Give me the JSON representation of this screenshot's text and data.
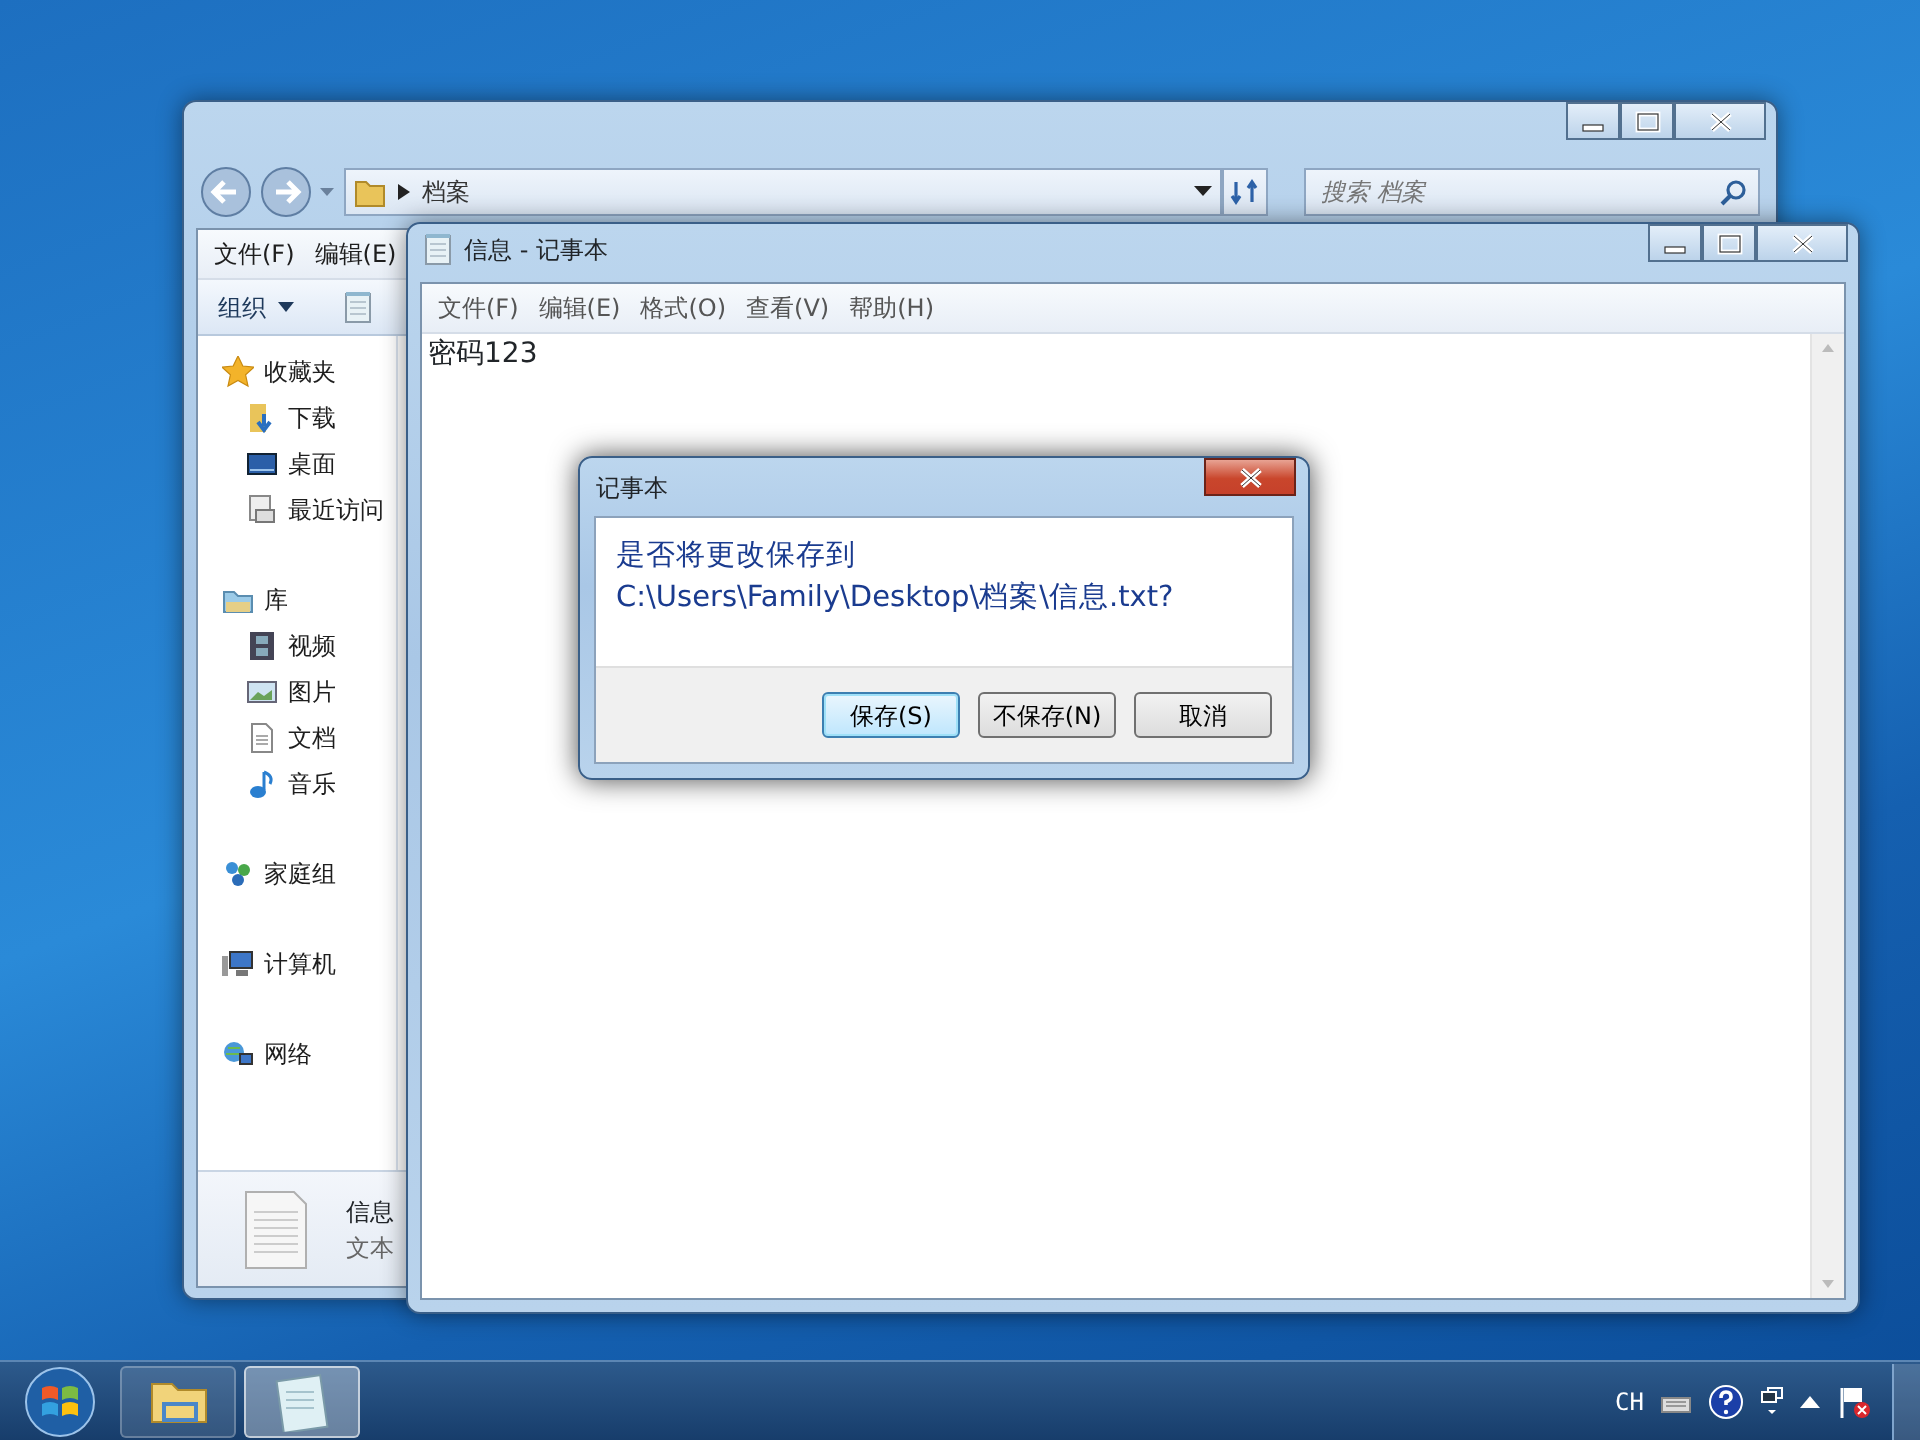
{
  "explorer": {
    "address": {
      "path": "档案"
    },
    "search": {
      "placeholder": "搜索 档案"
    },
    "menu": [
      "文件(F)",
      "编辑(E)"
    ],
    "toolbar": {
      "organize": "组织"
    },
    "sidebar": [
      {
        "label": "收藏夹",
        "children": [
          {
            "label": "下载"
          },
          {
            "label": "桌面"
          },
          {
            "label": "最近访问"
          }
        ]
      },
      {
        "label": "库",
        "children": [
          {
            "label": "视频"
          },
          {
            "label": "图片"
          },
          {
            "label": "文档"
          },
          {
            "label": "音乐"
          }
        ]
      },
      {
        "label": "家庭组"
      },
      {
        "label": "计算机"
      },
      {
        "label": "网络"
      }
    ],
    "details": {
      "name": "信息",
      "type": "文本"
    }
  },
  "notepad": {
    "title": "信息 - 记事本",
    "menu": [
      "文件(F)",
      "编辑(E)",
      "格式(O)",
      "查看(V)",
      "帮助(H)"
    ],
    "text": "密码123"
  },
  "dialog": {
    "title": "记事本",
    "message": "是否将更改保存到 C:\\Users\\Family\\Desktop\\档案\\信息.txt?",
    "buttons": [
      {
        "label": "保存(S)",
        "default": true
      },
      {
        "label": "不保存(N)",
        "default": false
      },
      {
        "label": "取消",
        "default": false
      }
    ]
  },
  "taskbar": {
    "items": [
      {
        "selected": false
      },
      {
        "selected": true
      }
    ],
    "language": "CH"
  }
}
